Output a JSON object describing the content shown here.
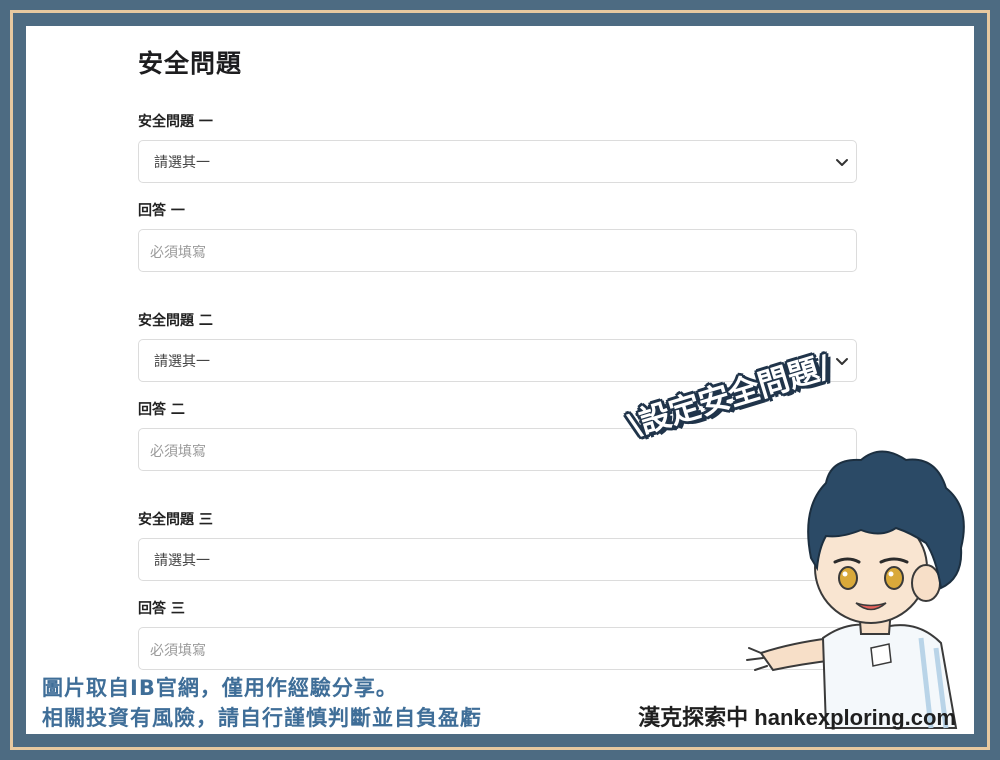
{
  "page": {
    "title": "安全問題",
    "questions": [
      {
        "question_label": "安全問題 一",
        "select_value": "請選其一",
        "answer_label": "回答 一",
        "answer_placeholder": "必須填寫"
      },
      {
        "question_label": "安全問題 二",
        "select_value": "請選其一",
        "answer_label": "回答 二",
        "answer_placeholder": "必須填寫"
      },
      {
        "question_label": "安全問題 三",
        "select_value": "請選其一",
        "answer_label": "回答 三",
        "answer_placeholder": "必須填寫"
      }
    ]
  },
  "overlay": {
    "banner_text": "\\設定安全問題/",
    "caption_line1": "圖片取自IB官網，僅用作經驗分享。",
    "caption_line2": "相關投資有風險，請自行謹慎判斷並自負盈虧",
    "credit": "漢克探索中 hankexploring.com"
  },
  "icons": {
    "select_chevron": "chevron-down-icon"
  },
  "colors": {
    "frame": "#4d6b82",
    "frame_line": "#e7c9a0",
    "caption": "#3f6e98",
    "banner_outline": "#20344a"
  }
}
